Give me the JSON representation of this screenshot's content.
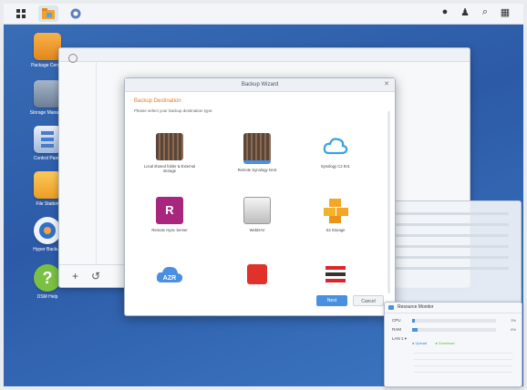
{
  "taskbar": {
    "icons": [
      "grid-icon",
      "file-station-icon",
      "control-panel-icon"
    ],
    "right_icons": [
      "notification-icon",
      "user-icon",
      "search-icon",
      "widgets-icon"
    ]
  },
  "desktop": {
    "icons": [
      {
        "label": "Package Center",
        "icon": "package-icon",
        "color": "#f29a2e"
      },
      {
        "label": "Storage Manager",
        "icon": "storage-icon",
        "color": "#7b8ea8"
      },
      {
        "label": "Control Panel",
        "icon": "control-panel-icon",
        "color": "#5b8dd6"
      },
      {
        "label": "File Station",
        "icon": "folder-icon",
        "color": "#f5b335"
      },
      {
        "label": "Hyper Backup",
        "icon": "backup-icon",
        "color": "#e8eef5"
      },
      {
        "label": "DSM Help",
        "icon": "help-icon",
        "color": "#79c142"
      }
    ]
  },
  "wizard": {
    "title": "Backup Wizard",
    "heading": "Backup Destination",
    "subtitle": "Please select your backup destination type:",
    "destinations": [
      {
        "label": "Local shared folder & External storage",
        "icon": "local-folder-icon"
      },
      {
        "label": "Remote Synology NAS",
        "icon": "remote-nas-icon"
      },
      {
        "label": "Synology C2 Ent.",
        "icon": "c2-cloud-icon"
      },
      {
        "label": "Remote rsync Server",
        "icon": "rsync-icon"
      },
      {
        "label": "WebDAV",
        "icon": "webdav-icon"
      },
      {
        "label": "S3 Storage",
        "icon": "s3-icon"
      },
      {
        "label": "",
        "icon": "azure-icon",
        "badge": "AZR"
      },
      {
        "label": "",
        "icon": "red-cloud-icon"
      },
      {
        "label": "",
        "icon": "stripes-icon"
      }
    ],
    "next_label": "Next",
    "cancel_label": "Cancel"
  },
  "resource_monitor": {
    "title": "Resource Monitor",
    "rows": [
      {
        "label": "CPU",
        "value": 3,
        "pct_label": "3%"
      },
      {
        "label": "RAM",
        "value": 6,
        "pct_label": "6%"
      },
      {
        "label": "LAN 1 ▾",
        "value": 0,
        "pct_label": ""
      }
    ],
    "legend": [
      "● Upload",
      "● Download"
    ]
  },
  "colors": {
    "accent": "#4a90e2",
    "heading": "#e47a2e"
  }
}
